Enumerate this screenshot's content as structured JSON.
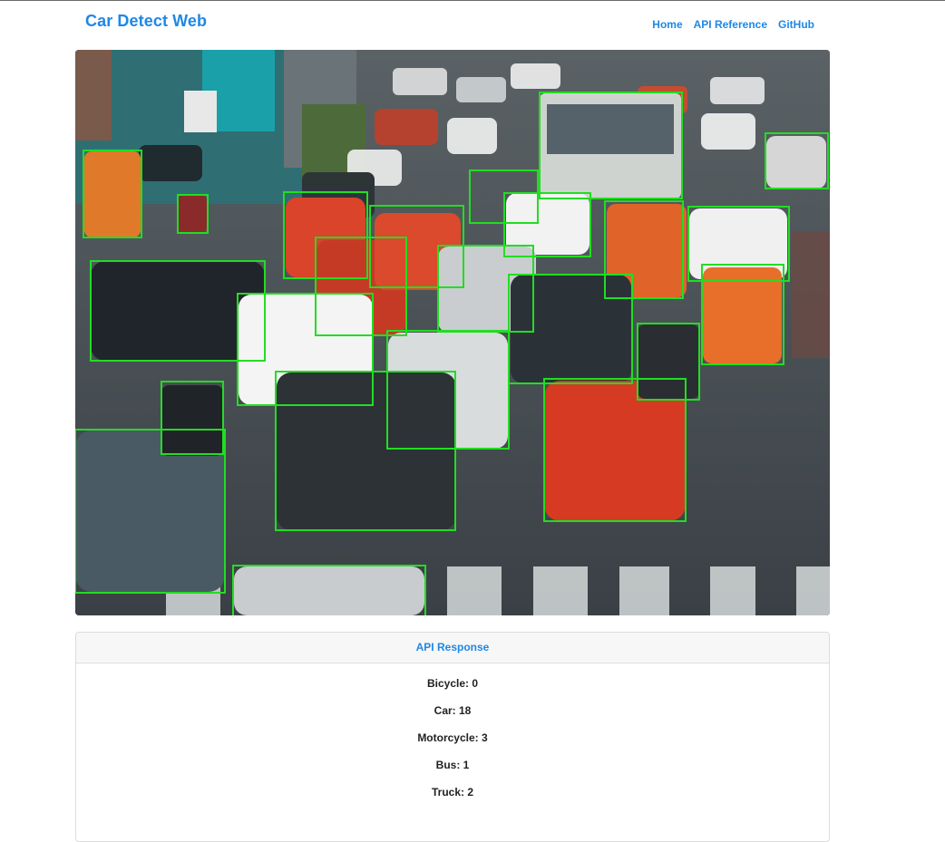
{
  "navbar": {
    "brand": "Car Detect Web",
    "links": [
      "Home",
      "API Reference",
      "GitHub"
    ]
  },
  "image": {
    "description_icon": "traffic-photo-with-detection-boxes",
    "box_color": "#22dd22"
  },
  "response": {
    "title": "API Response",
    "items": [
      {
        "label": "Bicycle: 0"
      },
      {
        "label": "Car: 18"
      },
      {
        "label": "Motorcycle: 3"
      },
      {
        "label": "Bus: 1"
      },
      {
        "label": "Truck: 2"
      }
    ]
  },
  "colors": {
    "accent": "#1e88e5",
    "box": "#22dd22"
  }
}
